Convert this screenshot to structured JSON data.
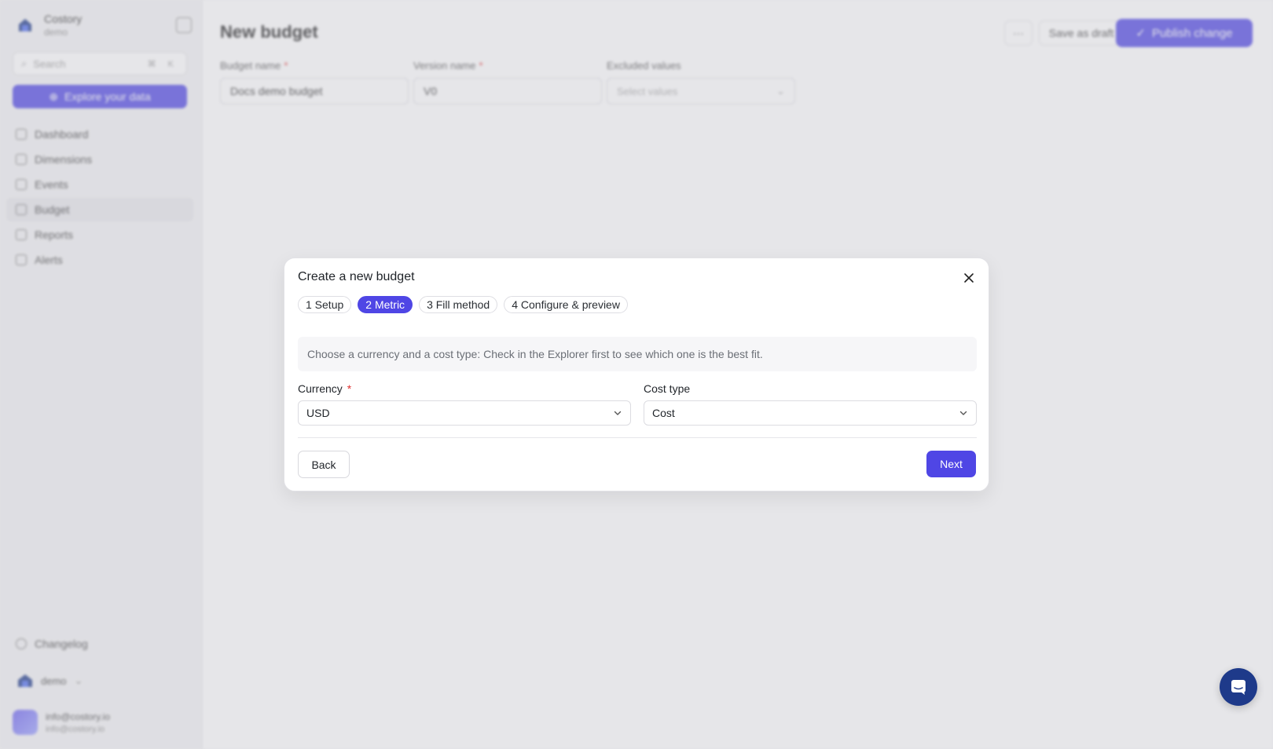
{
  "sidebar": {
    "org_name": "Costory",
    "org_sub": "demo",
    "search_placeholder": "Search",
    "search_shortcut": "⌘ K",
    "explore_label": "Explore your data",
    "items": [
      {
        "label": "Dashboard",
        "active": false
      },
      {
        "label": "Dimensions",
        "active": false
      },
      {
        "label": "Events",
        "active": false
      },
      {
        "label": "Budget",
        "active": true
      },
      {
        "label": "Reports",
        "active": false
      },
      {
        "label": "Alerts",
        "active": false
      }
    ],
    "changelog_label": "Changelog",
    "workspace_label": "demo",
    "user_name": "info@costory.io",
    "user_email": "info@costory.io"
  },
  "page": {
    "title": "New budget",
    "more_label": "···",
    "save_draft_label": "Save as draft",
    "publish_label": "Publish change",
    "fields": {
      "budget_name_label": "Budget name",
      "budget_name_value": "Docs demo budget",
      "version_name_label": "Version name",
      "version_name_value": "V0",
      "excluded_values_label": "Excluded values",
      "excluded_values_placeholder": "Select values"
    }
  },
  "modal": {
    "title": "Create a new budget",
    "steps": [
      {
        "label": "1 Setup",
        "active": false
      },
      {
        "label": "2 Metric",
        "active": true
      },
      {
        "label": "3 Fill method",
        "active": false
      },
      {
        "label": "4 Configure & preview",
        "active": false
      }
    ],
    "hint": "Choose a currency and a cost type: Check in the Explorer first to see which one is the best fit.",
    "currency_label": "Currency",
    "required_mark": "*",
    "currency_value": "USD",
    "cost_type_label": "Cost type",
    "cost_type_value": "Cost",
    "back_label": "Back",
    "next_label": "Next"
  },
  "colors": {
    "accent": "#4f46e5",
    "required": "#e03131",
    "chat_launcher": "#1e3a8a"
  }
}
